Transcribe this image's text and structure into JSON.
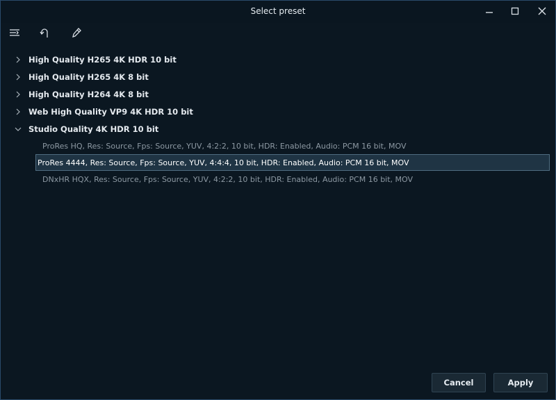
{
  "window": {
    "title": "Select preset"
  },
  "toolbar": {
    "icons": [
      "filter-list-icon",
      "undo-icon",
      "edit-pen-icon"
    ]
  },
  "groups": [
    {
      "label": "High Quality H265 4K HDR 10 bit",
      "expanded": false
    },
    {
      "label": "High Quality H265 4K 8 bit",
      "expanded": false
    },
    {
      "label": "High Quality H264 4K 8 bit",
      "expanded": false
    },
    {
      "label": "Web High Quality VP9 4K HDR 10 bit",
      "expanded": false
    },
    {
      "label": "Studio Quality 4K HDR 10 bit",
      "expanded": true,
      "presets": [
        {
          "label": "ProRes HQ, Res: Source, Fps: Source, YUV, 4:2:2, 10 bit, HDR: Enabled, Audio: PCM 16 bit, MOV",
          "selected": false
        },
        {
          "label": "ProRes 4444, Res: Source, Fps: Source, YUV, 4:4:4, 10 bit, HDR: Enabled, Audio: PCM 16 bit, MOV",
          "selected": true
        },
        {
          "label": "DNxHR HQX, Res: Source, Fps: Source, YUV, 4:2:2, 10 bit, HDR: Enabled, Audio: PCM 16 bit, MOV",
          "selected": false
        }
      ]
    }
  ],
  "buttons": {
    "cancel": "Cancel",
    "apply": "Apply"
  },
  "colors": {
    "background": "#0b1721",
    "selection": "#1f3444",
    "selection_border": "#4f6c80"
  }
}
